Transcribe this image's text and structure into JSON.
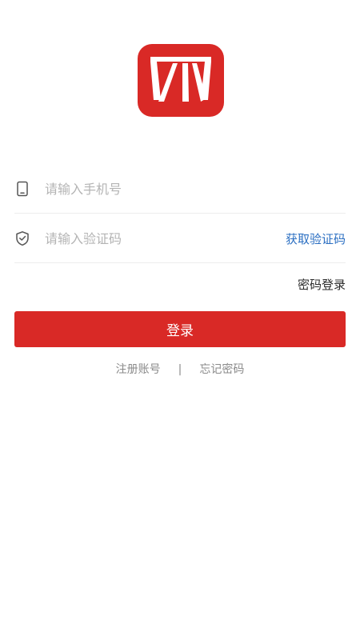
{
  "phone": {
    "placeholder": "请输入手机号",
    "value": ""
  },
  "code": {
    "placeholder": "请输入验证码",
    "value": "",
    "get_code_label": "获取验证码"
  },
  "password_login_label": "密码登录",
  "login_button_label": "登录",
  "footer": {
    "register_label": "注册账号",
    "separator": "|",
    "forgot_label": "忘记密码"
  },
  "icons": {
    "logo": "app-logo-icon",
    "phone": "phone-icon",
    "shield": "shield-check-icon"
  },
  "colors": {
    "brand_red": "#d92926",
    "link_blue": "#2b6fc2",
    "placeholder_gray": "#b4b4b4"
  }
}
